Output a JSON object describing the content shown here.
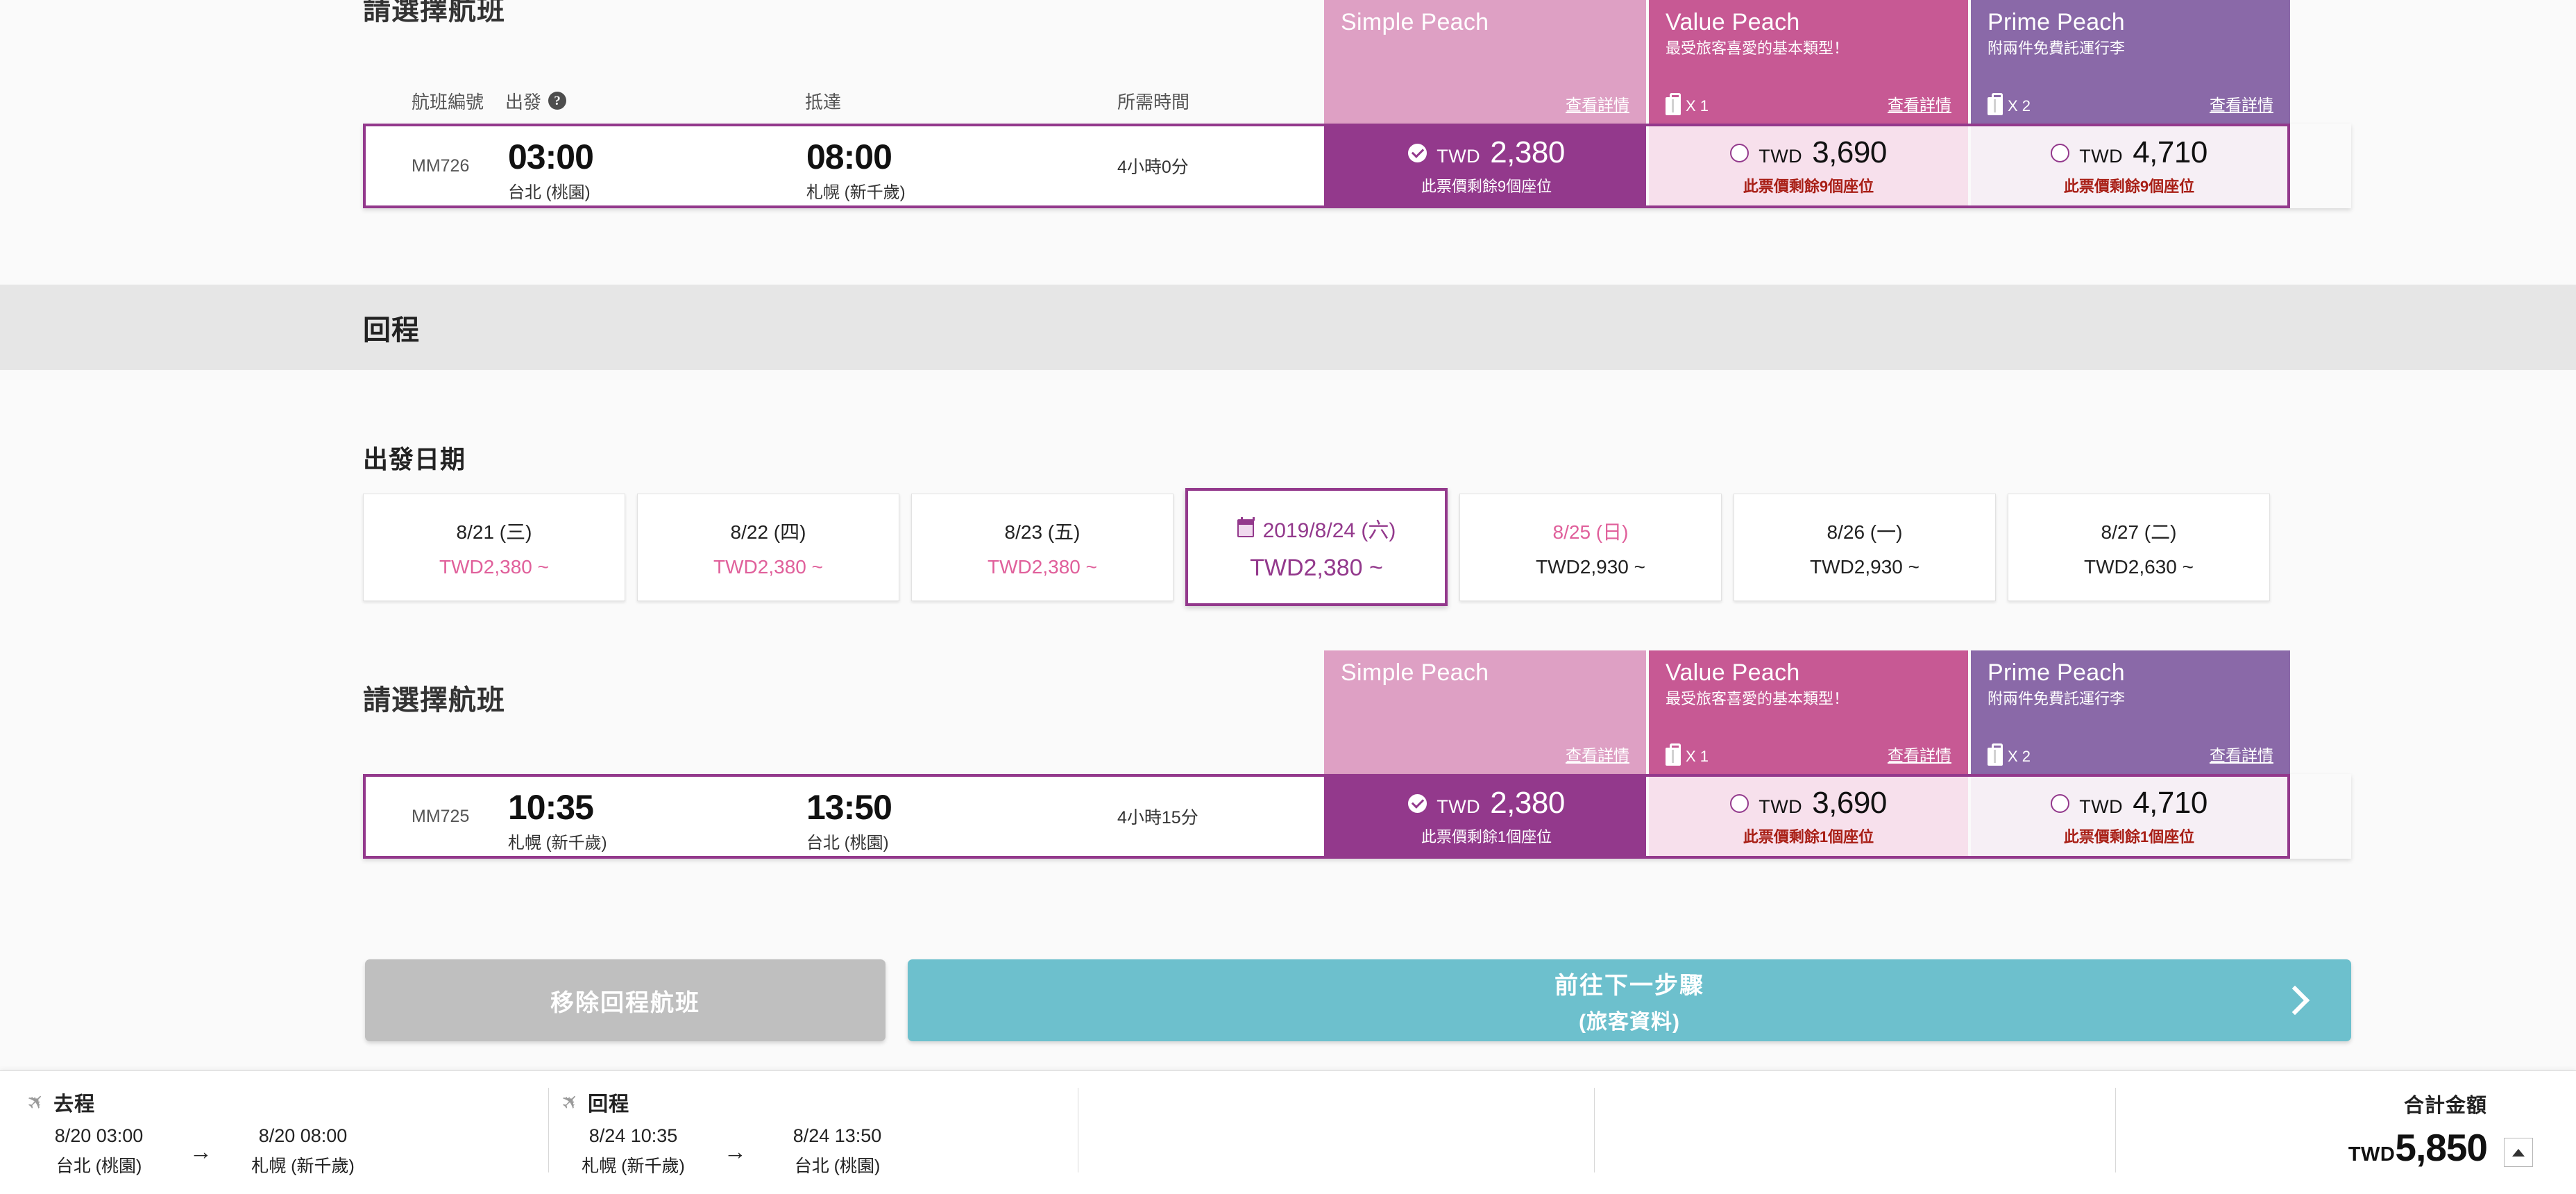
{
  "fare_classes": [
    {
      "name": "Simple Peach",
      "subtitle": "",
      "bag": "",
      "detail_link": "查看詳情",
      "header_color": "#dea0c4"
    },
    {
      "name": "Value Peach",
      "subtitle": "最受旅客喜愛的基本類型！",
      "bag": "X 1",
      "detail_link": "查看詳情",
      "header_color": "#c75994"
    },
    {
      "name": "Prime Peach",
      "subtitle": "附兩件免費託運行李",
      "bag": "X 2",
      "detail_link": "查看詳情",
      "header_color": "#8a69a8"
    }
  ],
  "table_headers": {
    "flight_no": "航班編號",
    "depart": "出發",
    "help_icon": "?",
    "arrive": "抵達",
    "duration": "所需時間"
  },
  "outbound": {
    "select_flight_title": "請選擇航班",
    "flight": {
      "flight_no": "MM726",
      "depart_time": "03:00",
      "depart_airport": "台北 (桃園)",
      "arrive_time": "08:00",
      "arrive_airport": "札幌 (新千歲)",
      "duration": "4小時0分"
    },
    "fares": [
      {
        "currency": "TWD",
        "amount": "2,380",
        "seats": "此票價剩餘9個座位",
        "selected": true
      },
      {
        "currency": "TWD",
        "amount": "3,690",
        "seats": "此票價剩餘9個座位",
        "selected": false
      },
      {
        "currency": "TWD",
        "amount": "4,710",
        "seats": "此票價剩餘9個座位",
        "selected": false
      }
    ]
  },
  "return_section": {
    "band_title": "回程",
    "date_label": "出發日期",
    "dates": [
      {
        "date": "8/21 (三)",
        "price": "TWD2,380 ~",
        "state": "normal"
      },
      {
        "date": "8/22 (四)",
        "price": "TWD2,380 ~",
        "state": "normal"
      },
      {
        "date": "8/23 (五)",
        "price": "TWD2,380 ~",
        "state": "normal"
      },
      {
        "date": "2019/8/24 (六)",
        "price": "TWD2,380 ~",
        "state": "selected"
      },
      {
        "date": "8/25 (日)",
        "price": "TWD2,930 ~",
        "state": "sunday"
      },
      {
        "date": "8/26 (一)",
        "price": "TWD2,930 ~",
        "state": "plain"
      },
      {
        "date": "8/27 (二)",
        "price": "TWD2,630 ~",
        "state": "plain"
      }
    ],
    "select_flight_title": "請選擇航班",
    "flight": {
      "flight_no": "MM725",
      "depart_time": "10:35",
      "depart_airport": "札幌 (新千歲)",
      "arrive_time": "13:50",
      "arrive_airport": "台北 (桃園)",
      "duration": "4小時15分"
    },
    "fares": [
      {
        "currency": "TWD",
        "amount": "2,380",
        "seats": "此票價剩餘1個座位",
        "selected": true
      },
      {
        "currency": "TWD",
        "amount": "3,690",
        "seats": "此票價剩餘1個座位",
        "selected": false
      },
      {
        "currency": "TWD",
        "amount": "4,710",
        "seats": "此票價剩餘1個座位",
        "selected": false
      }
    ]
  },
  "actions": {
    "remove_return": "移除回程航班",
    "next_main": "前往下一步驟",
    "next_sub": "(旅客資料)"
  },
  "summary": {
    "outbound": {
      "label": "去程",
      "depart_time": "8/20 03:00",
      "depart_airport": "台北 (桃園)",
      "arrow": "→",
      "arrive_time": "8/20 08:00",
      "arrive_airport": "札幌 (新千歲)"
    },
    "inbound": {
      "label": "回程",
      "depart_time": "8/24 10:35",
      "depart_airport": "札幌 (新千歲)",
      "arrow": "→",
      "arrive_time": "8/24 13:50",
      "arrive_airport": "台北 (桃園)"
    },
    "total_label": "合計金額",
    "total_currency": "TWD",
    "total_amount": "5,850"
  }
}
